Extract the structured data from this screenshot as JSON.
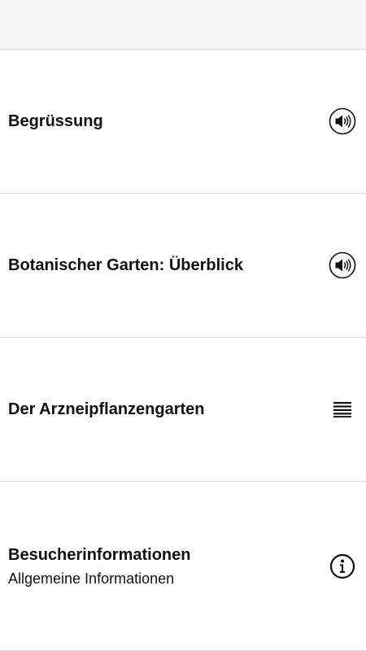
{
  "list": {
    "items": [
      {
        "title": "Begrüssung",
        "subtitle": "",
        "icon": "speaker-icon"
      },
      {
        "title": "Botanischer Garten: Überblick",
        "subtitle": "",
        "icon": "speaker-icon"
      },
      {
        "title": "Der Arzneipflanzengarten",
        "subtitle": "",
        "icon": "list-icon"
      },
      {
        "title": "Besucherinformationen",
        "subtitle": "Allgemeine Informationen",
        "icon": "info-icon"
      }
    ]
  },
  "colors": {
    "topbar": "#f5f5f5",
    "divider": "#d9d9d9",
    "text": "#111111"
  }
}
